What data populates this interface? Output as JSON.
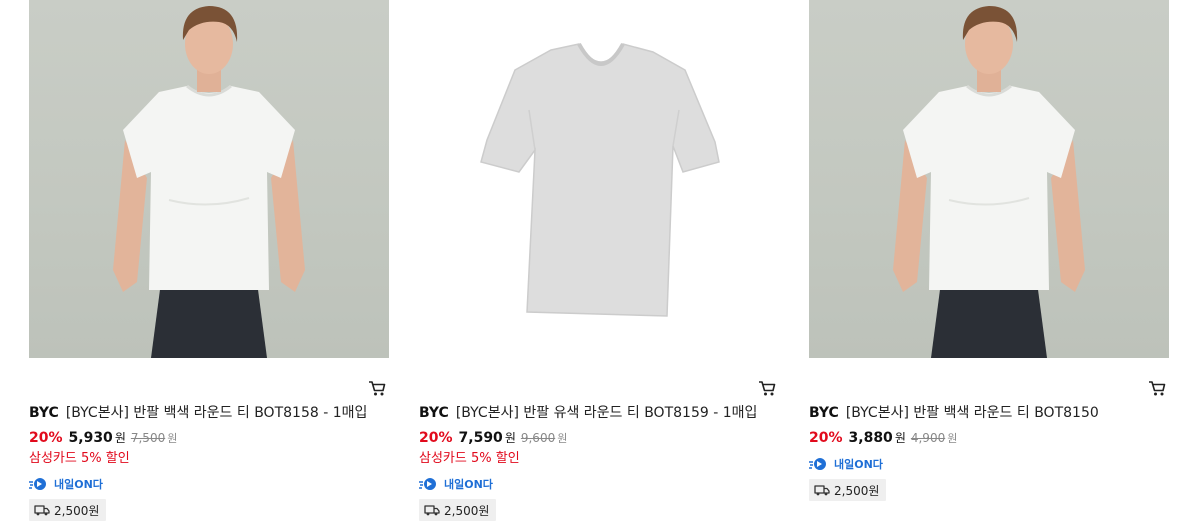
{
  "products": [
    {
      "brand": "BYC",
      "name": "[BYC본사] 반팔 백색 라운드 티 BOT8158 - 1매입",
      "discount": "20%",
      "price": "5,930",
      "price_unit": "원",
      "original_price": "7,500",
      "original_unit": "원",
      "promo": "삼성카드 5% 할인",
      "badge_label": "내일ON다",
      "shipping": "2,500원",
      "image_icon": "model-white-tshirt"
    },
    {
      "brand": "BYC",
      "name": "[BYC본사] 반팔 유색 라운드 티 BOT8159 - 1매입",
      "discount": "20%",
      "price": "7,590",
      "price_unit": "원",
      "original_price": "9,600",
      "original_unit": "원",
      "promo": "삼성카드 5% 할인",
      "badge_label": "내일ON다",
      "shipping": "2,500원",
      "image_icon": "grey-tshirt"
    },
    {
      "brand": "BYC",
      "name": "[BYC본사] 반팔 백색 라운드 티 BOT8150",
      "discount": "20%",
      "price": "3,880",
      "price_unit": "원",
      "original_price": "4,900",
      "original_unit": "원",
      "promo": "",
      "badge_label": "내일ON다",
      "shipping": "2,500원",
      "image_icon": "model-white-tshirt"
    }
  ],
  "colors": {
    "discount": "#e10a1c",
    "badge": "#1f6fd6",
    "ship_bg": "#efefef"
  },
  "icons": {
    "cart": "shopping-cart-icon",
    "truck": "delivery-truck-icon",
    "badge": "rocket-delivery-icon"
  }
}
